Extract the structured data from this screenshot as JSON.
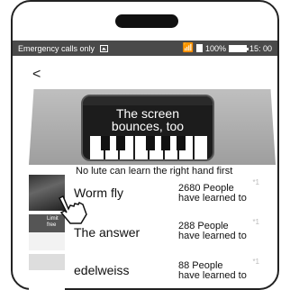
{
  "status_bar": {
    "carrier_text": "Emergency calls only",
    "battery_percent": "100%",
    "time": "15: 00",
    "icons": [
      "image-icon",
      "wifi-icon",
      "sim-icon",
      "battery-icon"
    ]
  },
  "nav": {
    "back_label": "<"
  },
  "banner": {
    "caption_line1": "The screen",
    "caption_line2": "bounces, too"
  },
  "intro_text": "No lute can learn the right hand first",
  "thumb_text": {
    "limit_free": "Limit\nfree"
  },
  "songs": [
    {
      "title": "Worm fly",
      "count_line1": "2680 People",
      "count_line2": "have learned to",
      "star": "*1"
    },
    {
      "title": "The answer",
      "count_line1": "288 People",
      "count_line2": "have learned to",
      "star": "*1"
    },
    {
      "title": "edelweiss",
      "count_line1": "88 People",
      "count_line2": "have learned to",
      "star": "*1"
    }
  ]
}
